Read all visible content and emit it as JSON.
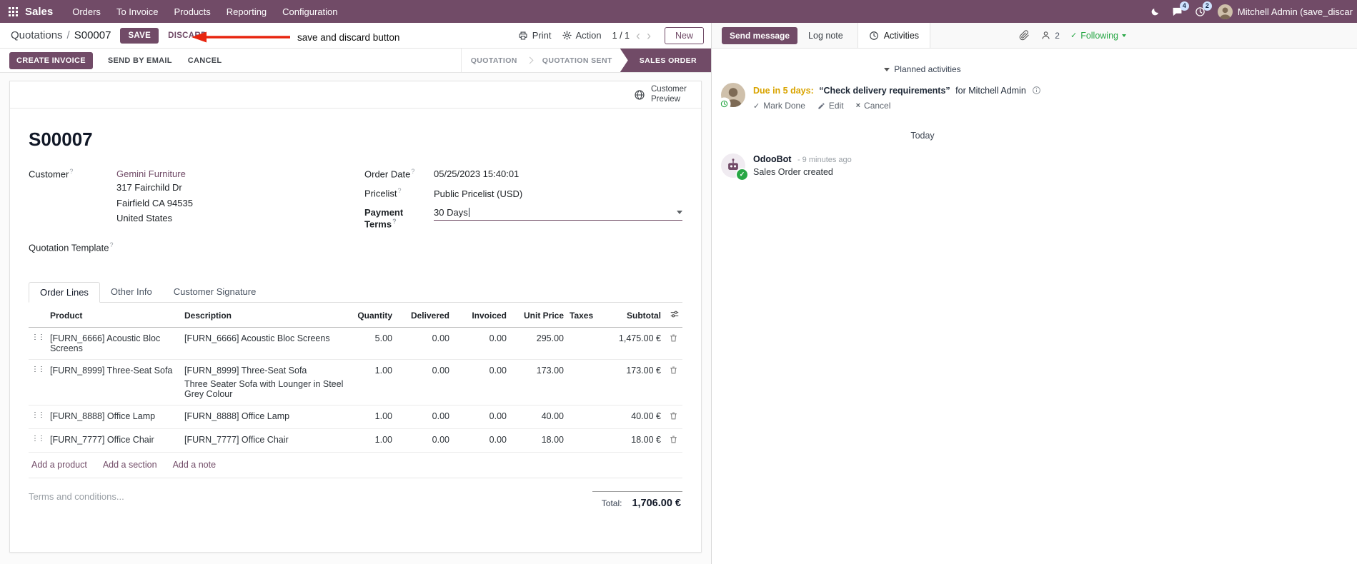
{
  "nav": {
    "brand": "Sales",
    "menu": [
      {
        "label": "Orders"
      },
      {
        "label": "To Invoice"
      },
      {
        "label": "Products"
      },
      {
        "label": "Reporting"
      },
      {
        "label": "Configuration"
      }
    ],
    "messages_badge": "4",
    "activities_badge": "2",
    "user_name": "Mitchell Admin (save_discar"
  },
  "control_panel": {
    "breadcrumb_parent": "Quotations",
    "separator": "/",
    "breadcrumb_current": "S00007",
    "save": "SAVE",
    "discard": "DISCARD",
    "print": "Print",
    "action": "Action",
    "pager": "1 / 1",
    "new": "New"
  },
  "annotation": {
    "label": "save and discard button"
  },
  "statusbar": {
    "create_invoice": "CREATE INVOICE",
    "send_by_email": "SEND BY EMAIL",
    "cancel": "CANCEL",
    "states": [
      {
        "label": "QUOTATION"
      },
      {
        "label": "QUOTATION SENT"
      },
      {
        "label": "SALES ORDER"
      }
    ]
  },
  "sheet": {
    "customer_preview": "Customer Preview",
    "help_mark": "?",
    "name": "S00007",
    "customer_label": "Customer",
    "customer_name": "Gemini Furniture",
    "customer_street": "317 Fairchild Dr",
    "customer_city": "Fairfield CA 94535",
    "customer_country": "United States",
    "quotation_template_label": "Quotation Template",
    "order_date_label": "Order Date",
    "order_date_value": "05/25/2023 15:40:01",
    "pricelist_label": "Pricelist",
    "pricelist_value": "Public Pricelist (USD)",
    "payment_terms_label": "Payment Terms",
    "payment_terms_value": "30 Days",
    "tabs": [
      {
        "label": "Order Lines"
      },
      {
        "label": "Other Info"
      },
      {
        "label": "Customer Signature"
      }
    ],
    "order_lines": {
      "headers": {
        "product": "Product",
        "description": "Description",
        "quantity": "Quantity",
        "delivered": "Delivered",
        "invoiced": "Invoiced",
        "unit_price": "Unit Price",
        "taxes": "Taxes",
        "subtotal": "Subtotal"
      },
      "rows": [
        {
          "product": "[FURN_6666] Acoustic Bloc Screens",
          "description": "[FURN_6666] Acoustic Bloc Screens",
          "description2": "",
          "quantity": "5.00",
          "delivered": "0.00",
          "invoiced": "0.00",
          "unit_price": "295.00",
          "taxes": "",
          "subtotal": "1,475.00 €"
        },
        {
          "product": "[FURN_8999] Three-Seat Sofa",
          "description": "[FURN_8999] Three-Seat Sofa",
          "description2": "Three Seater Sofa with Lounger in Steel Grey Colour",
          "quantity": "1.00",
          "delivered": "0.00",
          "invoiced": "0.00",
          "unit_price": "173.00",
          "taxes": "",
          "subtotal": "173.00 €"
        },
        {
          "product": "[FURN_8888] Office Lamp",
          "description": "[FURN_8888] Office Lamp",
          "description2": "",
          "quantity": "1.00",
          "delivered": "0.00",
          "invoiced": "0.00",
          "unit_price": "40.00",
          "taxes": "",
          "subtotal": "40.00 €"
        },
        {
          "product": "[FURN_7777] Office Chair",
          "description": "[FURN_7777] Office Chair",
          "description2": "",
          "quantity": "1.00",
          "delivered": "0.00",
          "invoiced": "0.00",
          "unit_price": "18.00",
          "taxes": "",
          "subtotal": "18.00 €"
        }
      ],
      "add_product": "Add a product",
      "add_section": "Add a section",
      "add_note": "Add a note"
    },
    "terms_placeholder": "Terms and conditions...",
    "total_label": "Total:",
    "total_value": "1,706.00 €"
  },
  "chatter": {
    "send_message": "Send message",
    "log_note": "Log note",
    "activities_tab": "Activities",
    "followers_count": "2",
    "following": "Following",
    "planned_header": "Planned activities",
    "activity": {
      "due": "Due in 5 days:",
      "summary": "“Check delivery requirements”",
      "assignee": "for Mitchell Admin",
      "mark_done": "Mark Done",
      "edit": "Edit",
      "cancel": "Cancel"
    },
    "date_separator": "Today",
    "message": {
      "author": "OdooBot",
      "time": "- 9 minutes ago",
      "body": "Sales Order created"
    }
  },
  "icons": {
    "check": "✓",
    "close": "×",
    "prev": "‹",
    "next": "›",
    "drag": "⋮⋮"
  }
}
